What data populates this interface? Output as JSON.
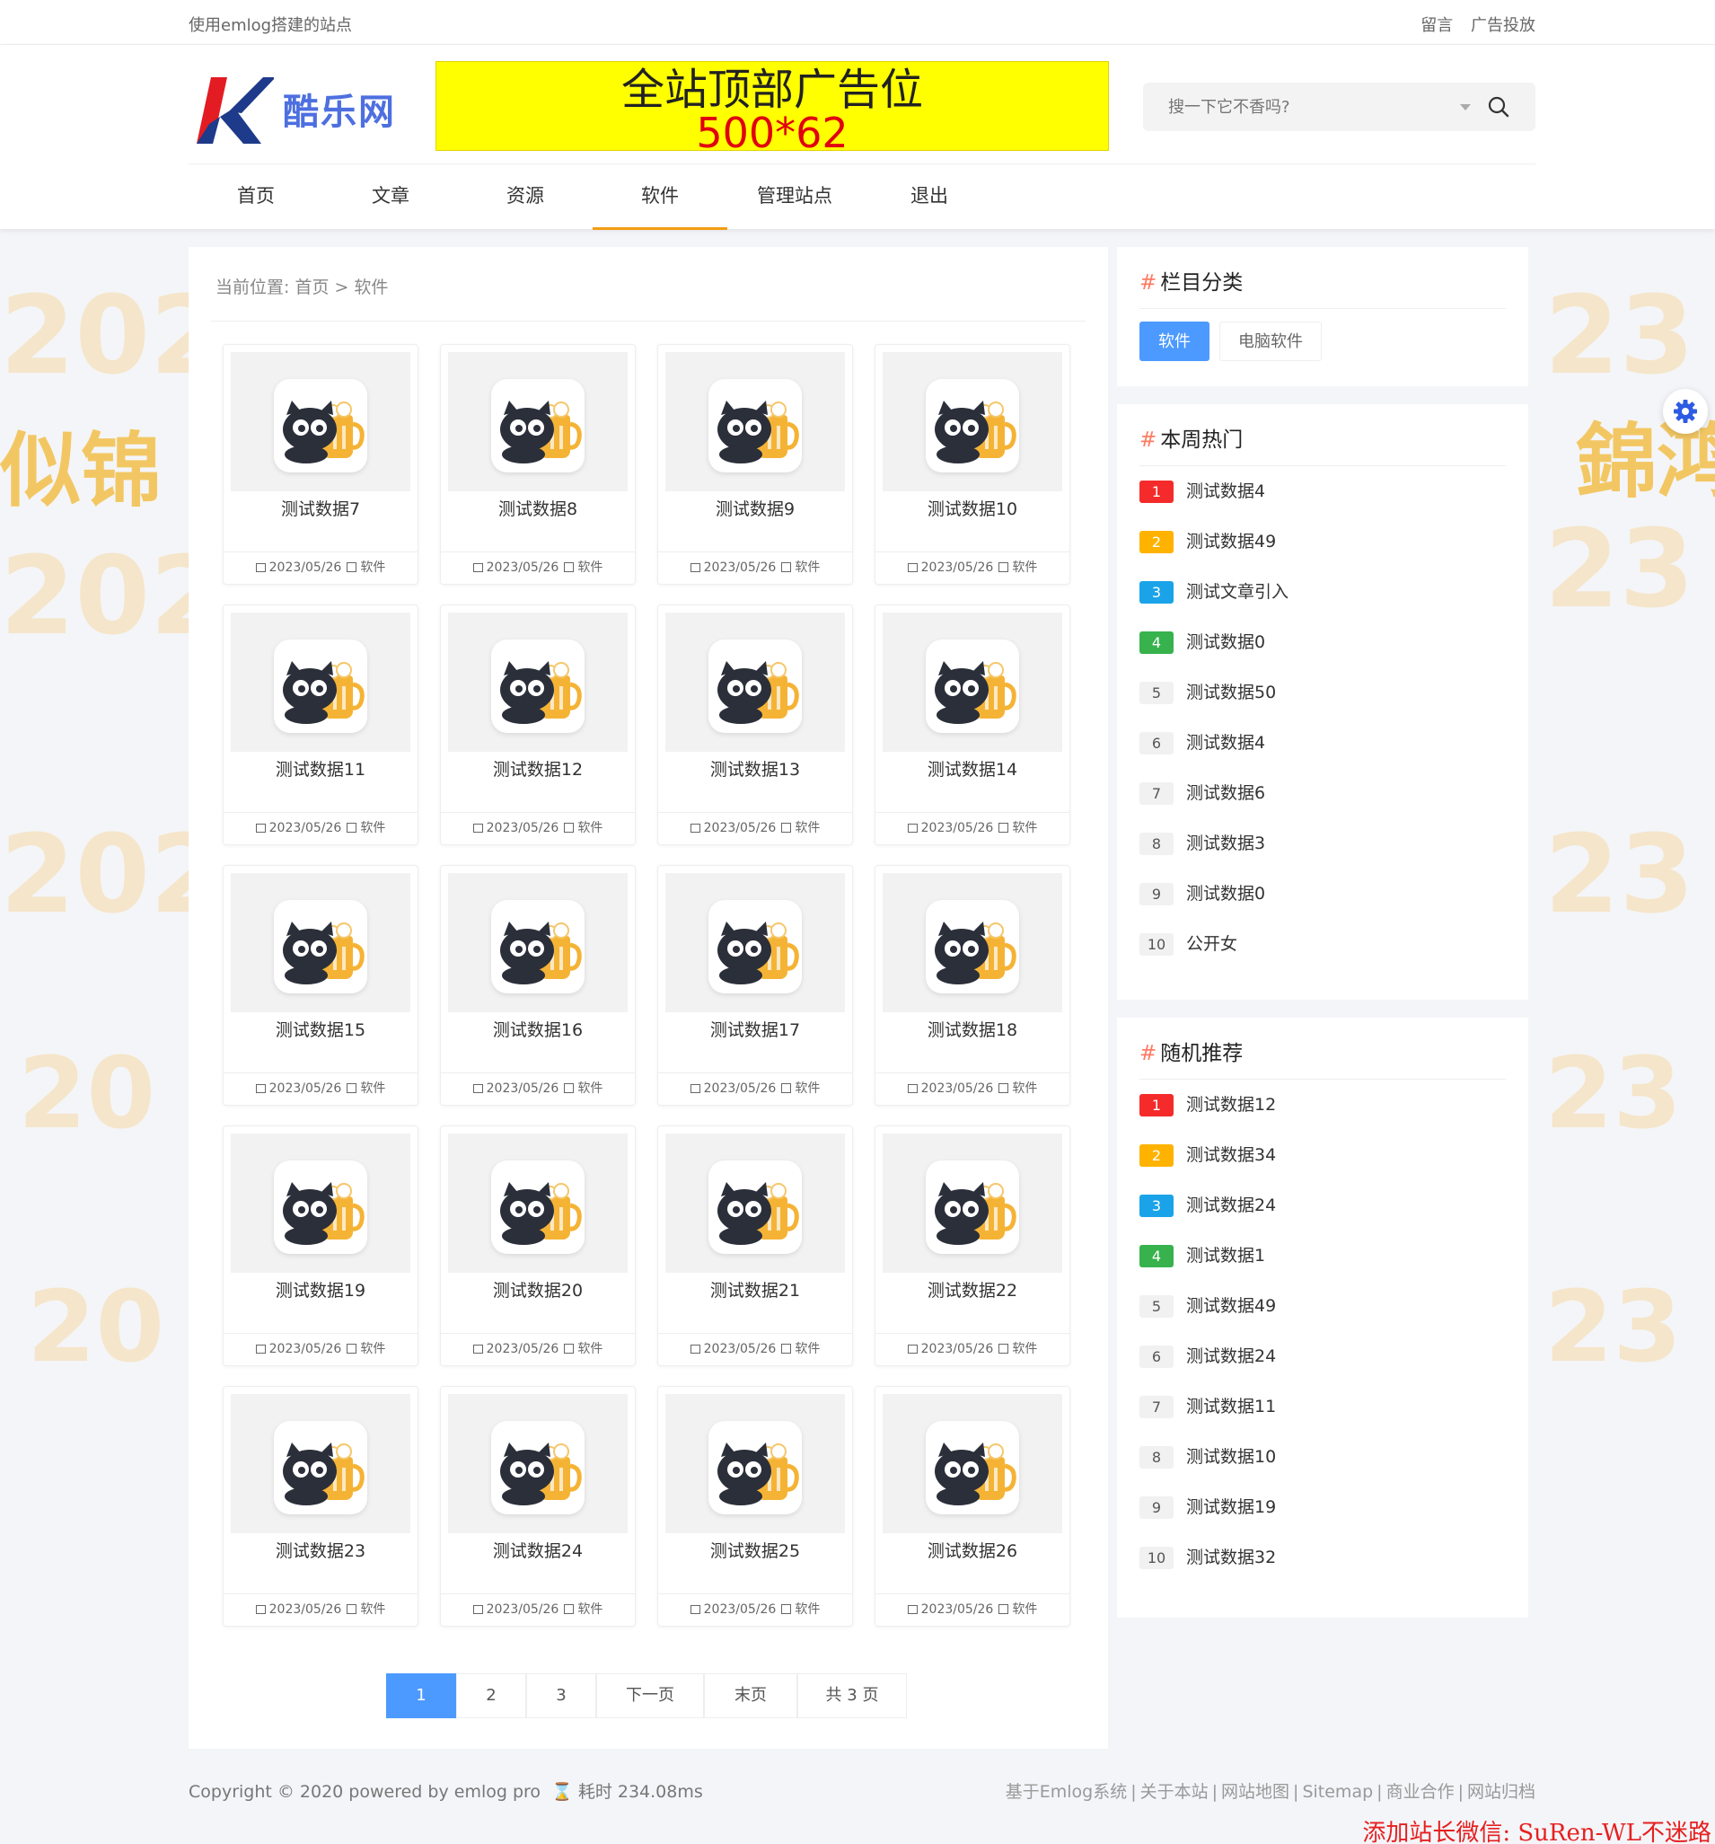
{
  "topbar": {
    "site_desc": "使用emlog搭建的站点",
    "links": [
      "留言",
      "广告投放"
    ]
  },
  "logo": {
    "text": "酷乐网"
  },
  "ad": {
    "line1": "全站顶部广告位",
    "line2": "500*62"
  },
  "search": {
    "placeholder": "搜一下它不香吗?"
  },
  "nav": {
    "items": [
      "首页",
      "文章",
      "资源",
      "软件",
      "管理站点",
      "退出"
    ],
    "active": "软件"
  },
  "breadcrumb": {
    "label": "当前位置:",
    "home": "首页",
    "sep": ">",
    "current": "软件"
  },
  "cards": [
    {
      "title": "测试数据7",
      "date": "2023/05/26",
      "category": "软件"
    },
    {
      "title": "测试数据8",
      "date": "2023/05/26",
      "category": "软件"
    },
    {
      "title": "测试数据9",
      "date": "2023/05/26",
      "category": "软件"
    },
    {
      "title": "测试数据10",
      "date": "2023/05/26",
      "category": "软件"
    },
    {
      "title": "测试数据11",
      "date": "2023/05/26",
      "category": "软件"
    },
    {
      "title": "测试数据12",
      "date": "2023/05/26",
      "category": "软件"
    },
    {
      "title": "测试数据13",
      "date": "2023/05/26",
      "category": "软件"
    },
    {
      "title": "测试数据14",
      "date": "2023/05/26",
      "category": "软件"
    },
    {
      "title": "测试数据15",
      "date": "2023/05/26",
      "category": "软件"
    },
    {
      "title": "测试数据16",
      "date": "2023/05/26",
      "category": "软件"
    },
    {
      "title": "测试数据17",
      "date": "2023/05/26",
      "category": "软件"
    },
    {
      "title": "测试数据18",
      "date": "2023/05/26",
      "category": "软件"
    },
    {
      "title": "测试数据19",
      "date": "2023/05/26",
      "category": "软件"
    },
    {
      "title": "测试数据20",
      "date": "2023/05/26",
      "category": "软件"
    },
    {
      "title": "测试数据21",
      "date": "2023/05/26",
      "category": "软件"
    },
    {
      "title": "测试数据22",
      "date": "2023/05/26",
      "category": "软件"
    },
    {
      "title": "测试数据23",
      "date": "2023/05/26",
      "category": "软件"
    },
    {
      "title": "测试数据24",
      "date": "2023/05/26",
      "category": "软件"
    },
    {
      "title": "测试数据25",
      "date": "2023/05/26",
      "category": "软件"
    },
    {
      "title": "测试数据26",
      "date": "2023/05/26",
      "category": "软件"
    }
  ],
  "pagination": {
    "pages": [
      "1",
      "2",
      "3"
    ],
    "current": "1",
    "next": "下一页",
    "last": "末页",
    "total": "共 3 页"
  },
  "sidebar": {
    "categories": {
      "title": "栏目分类",
      "items": [
        "软件",
        "电脑软件"
      ],
      "active": "软件"
    },
    "hot": {
      "title": "本周热门",
      "items": [
        "测试数据4",
        "测试数据49",
        "测试文章引入",
        "测试数据0",
        "测试数据50",
        "测试数据4",
        "测试数据6",
        "测试数据3",
        "测试数据0",
        "公开女"
      ]
    },
    "random": {
      "title": "随机推荐",
      "items": [
        "测试数据12",
        "测试数据34",
        "测试数据24",
        "测试数据1",
        "测试数据49",
        "测试数据24",
        "测试数据11",
        "测试数据10",
        "测试数据19",
        "测试数据32"
      ]
    }
  },
  "footer": {
    "copyright": "Copyright © 2020 powered by emlog pro",
    "timing": "耗时 234.08ms",
    "links": [
      "基于Emlog系统",
      "关于本站",
      "网站地图",
      "Sitemap",
      "商业合作",
      "网站归档"
    ]
  },
  "watermark": "添加站长微信: SuRen-WL不迷路",
  "colors": {
    "accent": "#4c9aff",
    "nav_active": "#f39c12",
    "rank1": "#f52b2b",
    "rank2": "#ffb300",
    "rank3": "#1aa3e8",
    "rank4": "#37b24d",
    "ad_bg": "#ffff00"
  }
}
